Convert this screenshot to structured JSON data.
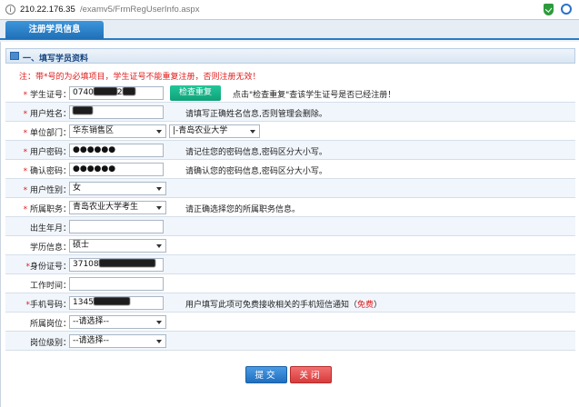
{
  "browser": {
    "host": "210.22.176.35",
    "path": "/examv5/FrmRegUserInfo.aspx"
  },
  "tab": {
    "label": "注册学员信息"
  },
  "section": {
    "title": "一、填写学员资料"
  },
  "notice": "注：带*号的为必填项目，学生证号不能重复注册，否则注册无效！",
  "form": {
    "student_id": {
      "label": "学生证号：",
      "value": "0740",
      "tail": "2",
      "check_button": "检查重复",
      "hint": "点击\"检查重复\"查该学生证号是否已经注册！"
    },
    "name": {
      "label": "用户姓名：",
      "value": "",
      "hint": "请填写正确姓名信息,否则管理会删除。"
    },
    "unit": {
      "label": "单位部门：",
      "value": "华东销售区",
      "value2": "|-青岛农业大学"
    },
    "password": {
      "label": "用户密码：",
      "value": "●●●●●●",
      "hint": "请记住您的密码信息,密码区分大小写。"
    },
    "confirm_password": {
      "label": "确认密码：",
      "value": "●●●●●●",
      "hint": "请确认您的密码信息,密码区分大小写。"
    },
    "gender": {
      "label": "用户性别：",
      "value": "女"
    },
    "position": {
      "label": "所属职务：",
      "value": "青岛农业大学考生",
      "hint": "请正确选择您的所属职务信息。"
    },
    "birth": {
      "label": "出生年月：",
      "value": ""
    },
    "education": {
      "label": "学历信息：",
      "value": "硕士"
    },
    "id_card": {
      "label": "身份证号：",
      "value": "37108"
    },
    "work_time": {
      "label": "工作时间：",
      "value": ""
    },
    "mobile": {
      "label": "手机号码：",
      "value": "1345",
      "hint": "用户填写此项可免费接收相关的手机短信通知（",
      "hint_free": "免费",
      "hint_end": "）"
    },
    "post": {
      "label": "所属岗位：",
      "value": "--请选择--"
    },
    "level": {
      "label": "岗位级别：",
      "value": "--请选择--"
    }
  },
  "buttons": {
    "submit": "提交",
    "close": "关闭"
  },
  "colors": {
    "accent": "#2a7cc4",
    "required": "#e01b1b",
    "check": "#10a178",
    "close": "#d83b3b"
  }
}
